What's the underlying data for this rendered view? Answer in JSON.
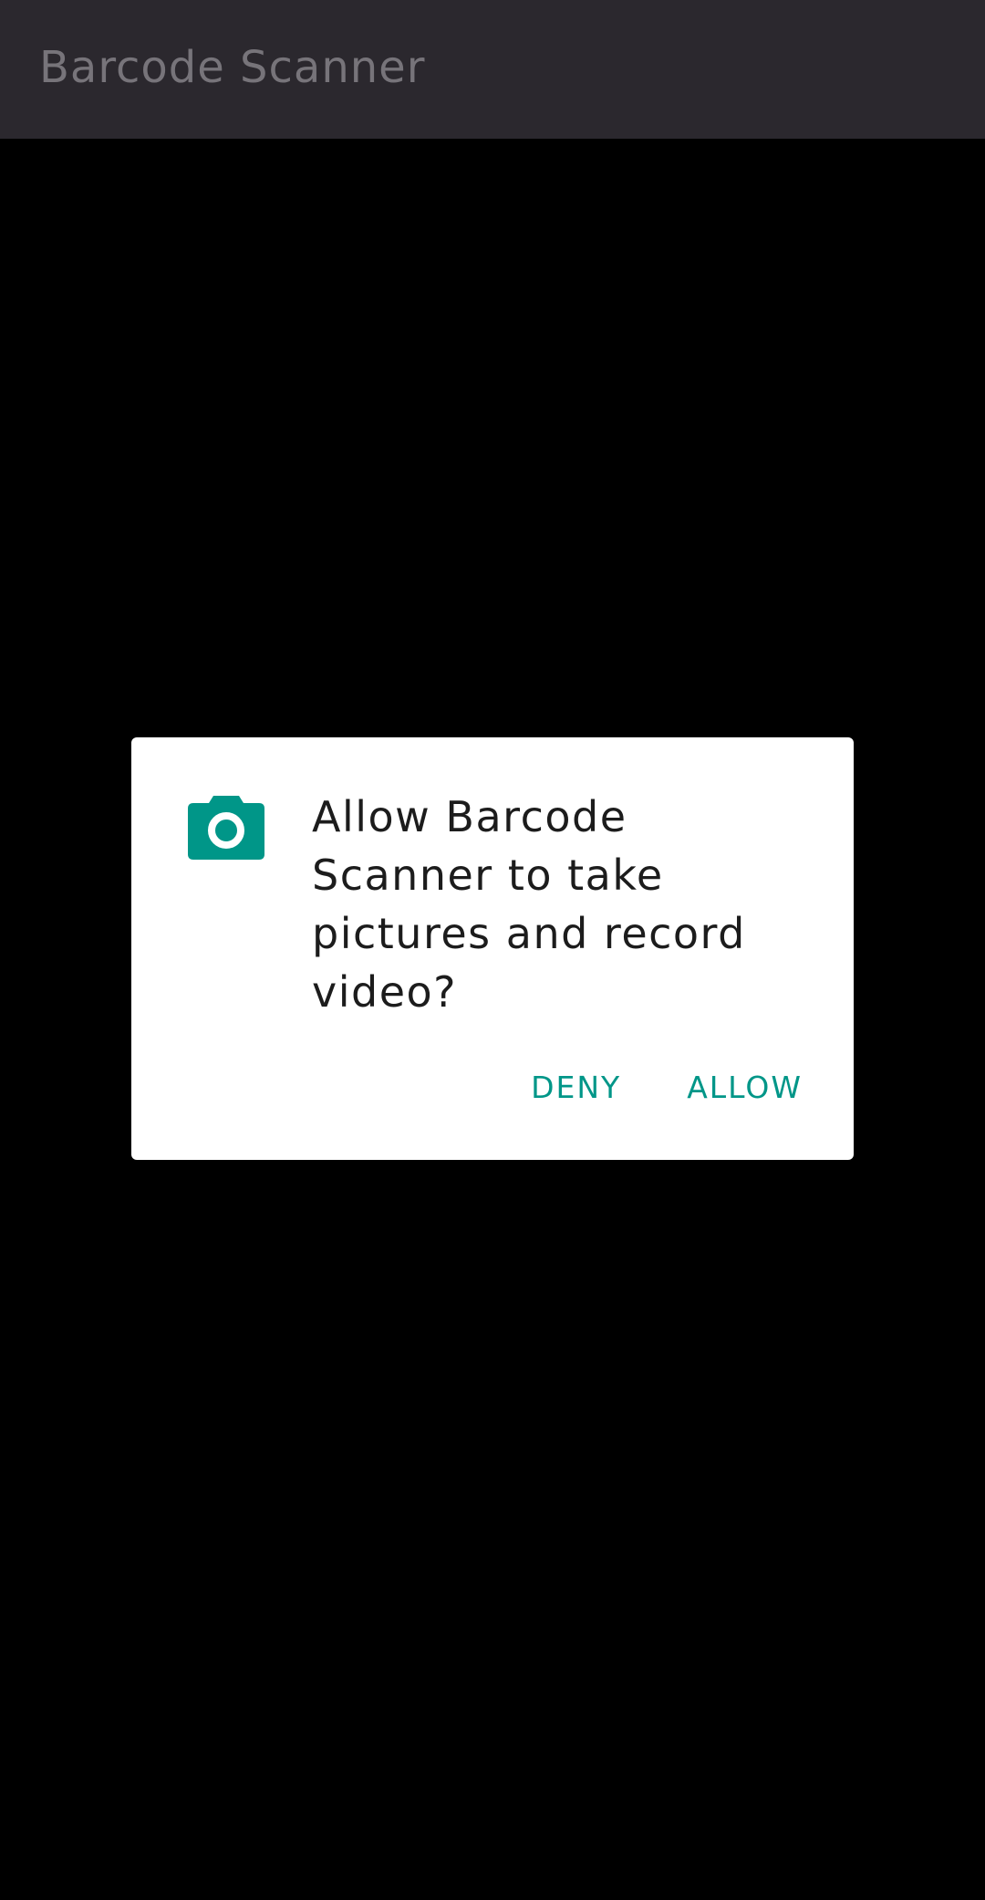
{
  "app_bar": {
    "title": "Barcode Scanner"
  },
  "permission_dialog": {
    "icon": "camera-icon",
    "message": "Allow Barcode Scanner to take pictures and record video?",
    "deny_label": "DENY",
    "allow_label": "ALLOW"
  },
  "colors": {
    "app_bar": "#2b282e",
    "background": "#000000",
    "accent": "#009688",
    "dialog": "#ffffff"
  }
}
